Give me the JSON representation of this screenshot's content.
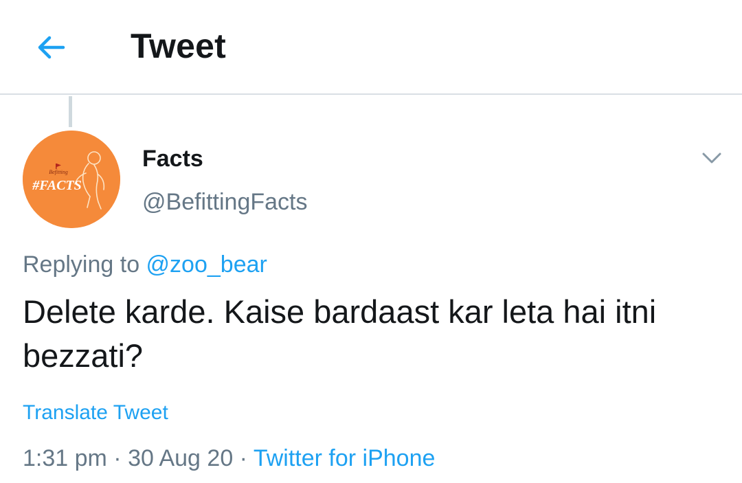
{
  "header": {
    "title": "Tweet",
    "back_icon": "arrow-left-icon",
    "accent_color": "#1da1f2"
  },
  "tweet": {
    "author": {
      "display_name": "Facts",
      "handle": "@BefittingFacts",
      "avatar": {
        "small_text": "Befitting",
        "main_text": "#FACTS",
        "background_color": "#f58a3a"
      }
    },
    "more_icon": "chevron-down-icon",
    "replying_prefix": "Replying to ",
    "replying_to": "@zoo_bear",
    "text": "Delete karde. Kaise bardaast kar leta hai itni bezzati?",
    "translate_label": "Translate Tweet",
    "time": "1:31 pm",
    "separator": " · ",
    "date": "30 Aug 20",
    "source": "Twitter for iPhone"
  }
}
